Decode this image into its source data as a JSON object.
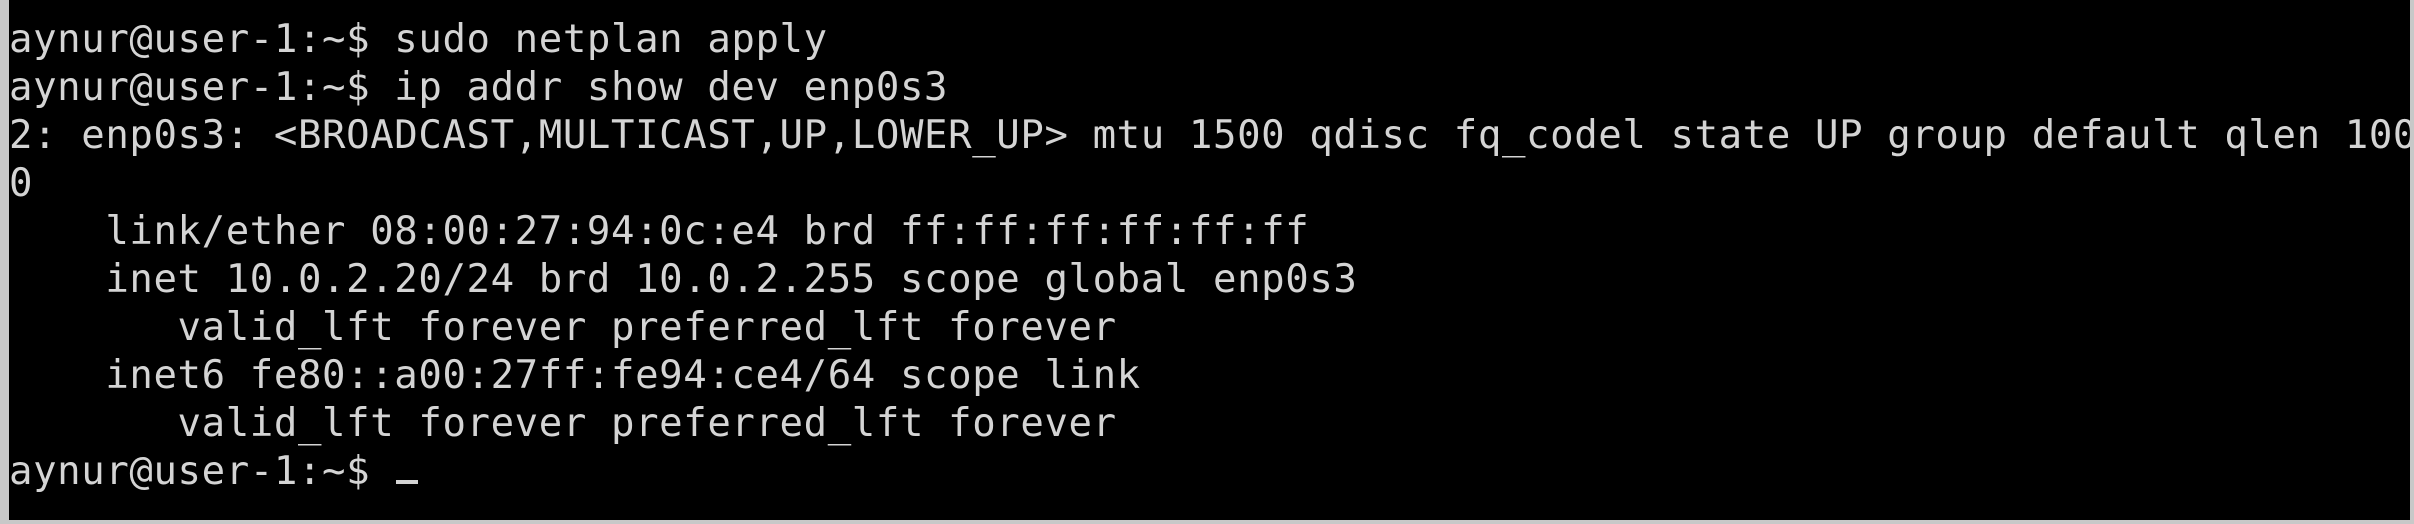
{
  "terminal": {
    "lines": [
      "aynur@user-1:~$ sudo netplan apply",
      "aynur@user-1:~$ ip addr show dev enp0s3",
      "2: enp0s3: <BROADCAST,MULTICAST,UP,LOWER_UP> mtu 1500 qdisc fq_codel state UP group default qlen 100",
      "0",
      "    link/ether 08:00:27:94:0c:e4 brd ff:ff:ff:ff:ff:ff",
      "    inet 10.0.2.20/24 brd 10.0.2.255 scope global enp0s3",
      "       valid_lft forever preferred_lft forever",
      "    inet6 fe80::a00:27ff:fe94:ce4/64 scope link",
      "       valid_lft forever preferred_lft forever"
    ],
    "prompt": "aynur@user-1:~$ "
  },
  "colors": {
    "background": "#000000",
    "foreground": "#d4d4d4",
    "frame": "#c8c8c8"
  }
}
